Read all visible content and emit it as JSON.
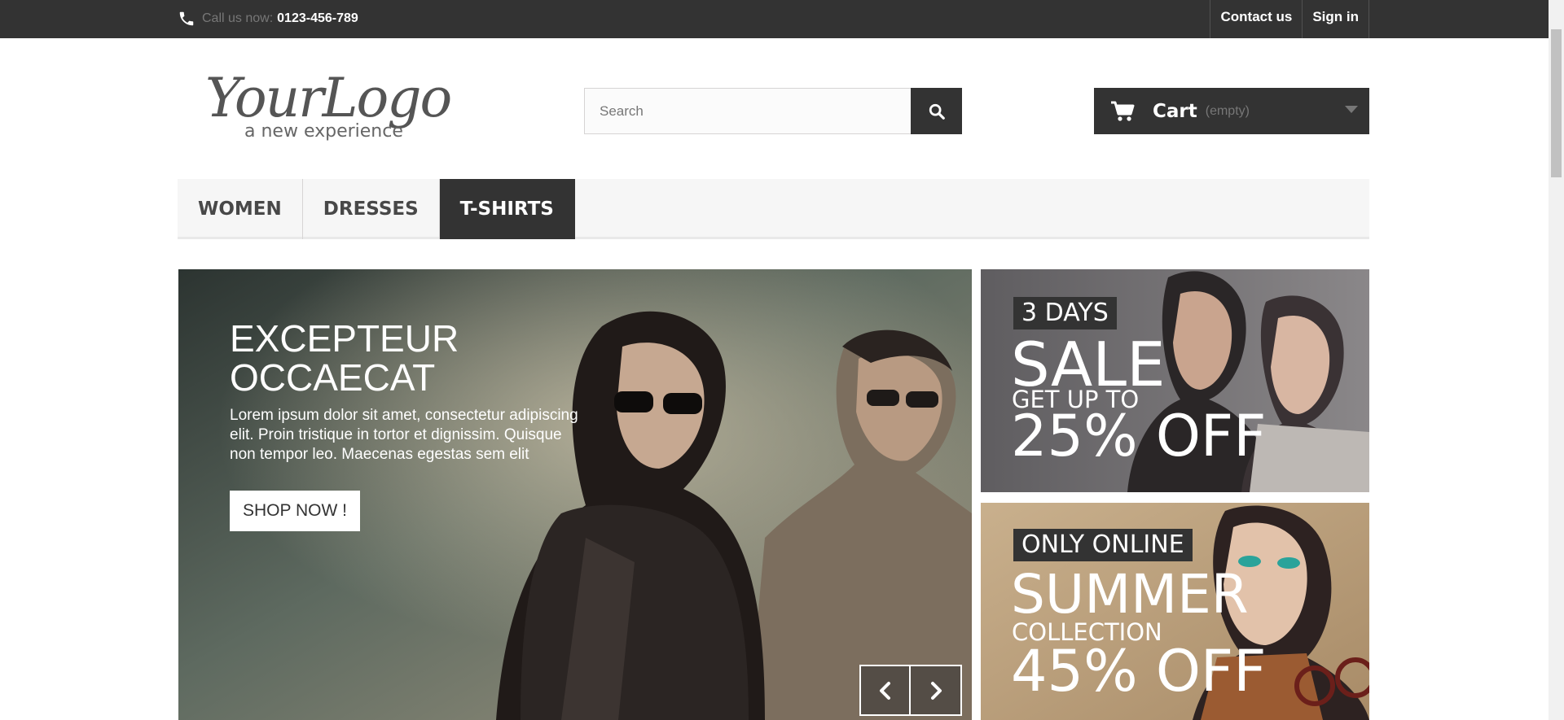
{
  "topbar": {
    "call_label": "Call us now:",
    "phone": "0123-456-789",
    "links": [
      "Contact us",
      "Sign in"
    ]
  },
  "logo": {
    "main": "YourLogo",
    "tagline": "a new experience"
  },
  "search": {
    "placeholder": "Search",
    "icon": "search-icon"
  },
  "cart": {
    "label": "Cart",
    "state": "(empty)",
    "icon": "cart-icon"
  },
  "nav": {
    "items": [
      "WOMEN",
      "DRESSES",
      "T-SHIRTS"
    ],
    "active": "T-SHIRTS"
  },
  "hero": {
    "title_line1": "EXCEPTEUR",
    "title_line2": "OCCAECAT",
    "text": "Lorem ipsum dolor sit amet, consectetur adipiscing elit. Proin tristique in tortor et dignissim. Quisque non tempor leo. Maecenas egestas sem elit",
    "button": "SHOP NOW !"
  },
  "banner1": {
    "tag": "3 DAYS",
    "big": "SALE",
    "small": "GET UP TO",
    "pct": "25% OFF"
  },
  "banner2": {
    "tag": "ONLY ONLINE",
    "big": "SUMMER",
    "small": "COLLECTION",
    "pct": "45% OFF"
  },
  "colors": {
    "dark": "#333333",
    "nav_bg": "#f6f6f6",
    "muted": "#777777"
  }
}
